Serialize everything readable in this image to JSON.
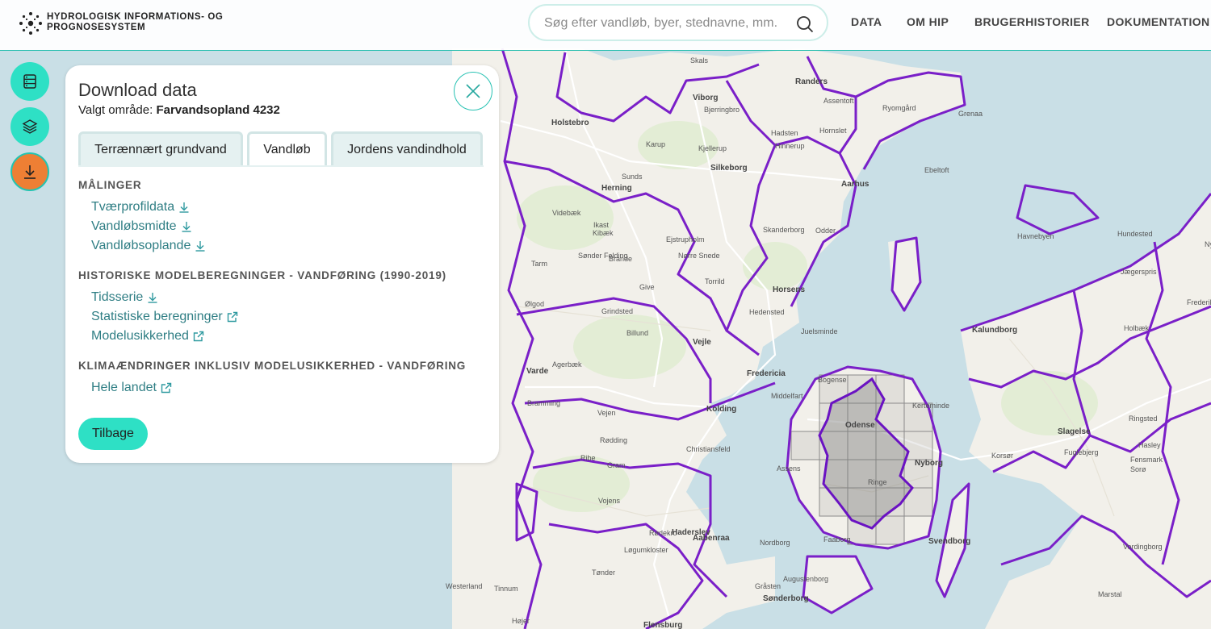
{
  "header": {
    "brand_line1": "HYDROLOGISK INFORMATIONS- OG",
    "brand_line2": "PROGNOSESYSTEM",
    "search_placeholder": "Søg efter vandløb, byer, stednavne, mm.",
    "nav": [
      "DATA",
      "OM HIP",
      "BRUGERHISTORIER",
      "DOKUMENTATION"
    ]
  },
  "sidebar": {
    "buttons": [
      {
        "icon": "database-icon",
        "color": "#2ee0c5"
      },
      {
        "icon": "layers-icon",
        "color": "#2ee0c5"
      },
      {
        "icon": "download-icon",
        "color": "#ee7f34"
      }
    ]
  },
  "panel": {
    "title": "Download data",
    "selected_label": "Valgt område:",
    "selected_value": "Farvandsopland 4232",
    "tabs": [
      {
        "label": "Terrænnært grundvand",
        "active": false
      },
      {
        "label": "Vandløb",
        "active": true
      },
      {
        "label": "Jordens vandindhold",
        "active": false
      }
    ],
    "sections": [
      {
        "title": "MÅLINGER",
        "links": [
          {
            "label": "Tværprofildata",
            "icon": "download-icon"
          },
          {
            "label": "Vandløbsmidte",
            "icon": "download-icon"
          },
          {
            "label": "Vandløbsoplande",
            "icon": "download-icon"
          }
        ]
      },
      {
        "title": "HISTORISKE MODELBEREGNINGER - VANDFØRING (1990-2019)",
        "links": [
          {
            "label": "Tidsserie",
            "icon": "download-icon"
          },
          {
            "label": "Statistiske beregninger",
            "icon": "external-link-icon"
          },
          {
            "label": "Modelusikkerhed",
            "icon": "external-link-icon"
          }
        ]
      },
      {
        "title": "KLIMAÆNDRINGER INKLUSIV MODELUSIKKERHED - VANDFØRING",
        "links": [
          {
            "label": "Hele landet",
            "icon": "external-link-icon"
          }
        ]
      }
    ],
    "back_label": "Tilbage"
  },
  "map": {
    "labels": [
      "Skals",
      "Randers",
      "Viborg",
      "Holstebro",
      "Bjerringbro",
      "Assentoft",
      "Ryomgård",
      "Grenaa",
      "Hadsten",
      "Hinnerup",
      "Hornslet",
      "Kjellerup",
      "Karup",
      "Silkeborg",
      "Aarhus",
      "Herning",
      "Sunds",
      "Ebeltoft",
      "Videbæk",
      "Ikast",
      "Skanderborg",
      "Odder",
      "Kibæk",
      "Brande",
      "Ejstrupholm",
      "Nørre Snede",
      "Tarm",
      "Sønder Felding",
      "Give",
      "Torrild",
      "Horsens",
      "Hedensted",
      "Grindsted",
      "Billund",
      "Juelsminde",
      "Vejle",
      "Ølgod",
      "Agerbæk",
      "Fredericia",
      "Varde",
      "Bramming",
      "Middelfart",
      "Kolding",
      "Odense",
      "Nyborg",
      "Kerteminde",
      "Bogense",
      "Ringe",
      "Faaborg",
      "Svendborg",
      "Vejen",
      "Rødding",
      "Ribe",
      "Gram",
      "Vojens",
      "Haderslev",
      "Christiansfeld",
      "Assens",
      "Rødekro",
      "Aabenraa",
      "Løgumkloster",
      "Tønder",
      "Gråsten",
      "Sønderborg",
      "Augustenborg",
      "Nordborg",
      "Flensburg",
      "Westerland",
      "Tinnum",
      "Højer",
      "Kalundborg",
      "Holbæk",
      "Slagelse",
      "Sorø",
      "Ringsted",
      "Korsør",
      "Hasley",
      "Fensmark",
      "Fuglebjerg",
      "Vordingborg",
      "Havnebyen",
      "Nykøbing",
      "Hundested",
      "Jægerspris",
      "Frederikssund",
      "Marstal"
    ],
    "border_color": "#7a1fc8"
  }
}
